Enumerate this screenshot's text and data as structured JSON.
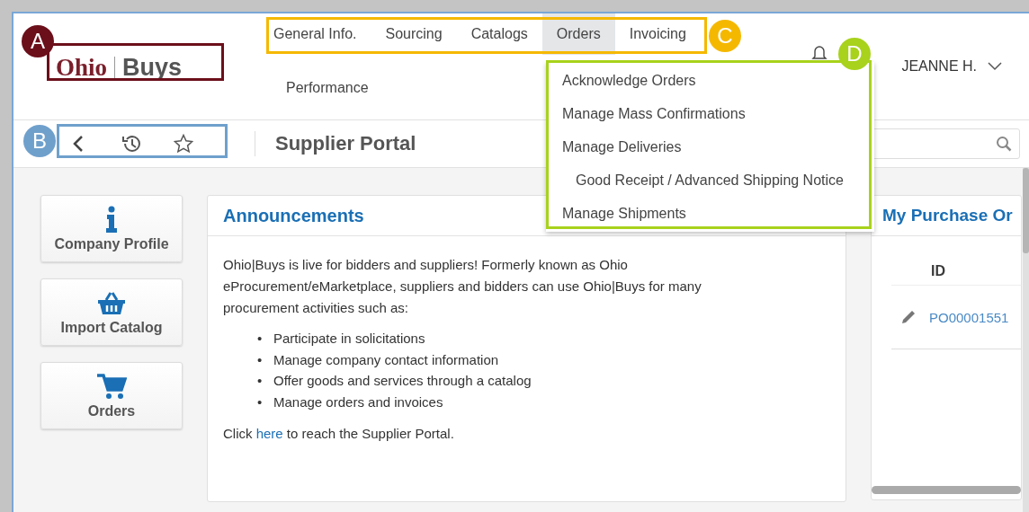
{
  "logo": {
    "name": "Ohio",
    "suffix": "Buys"
  },
  "nav": [
    {
      "label": "General Info.",
      "selected": false
    },
    {
      "label": "Sourcing",
      "selected": false
    },
    {
      "label": "Catalogs",
      "selected": false
    },
    {
      "label": "Orders",
      "selected": true
    },
    {
      "label": "Invoicing",
      "selected": false
    },
    {
      "label": "Performance",
      "selected": false
    }
  ],
  "user": {
    "name": "JEANNE H."
  },
  "toolbar": {
    "title": "Supplier Portal"
  },
  "tiles": [
    {
      "kind": "info",
      "label": "Company Profile"
    },
    {
      "kind": "basket",
      "label": "Import Catalog"
    },
    {
      "kind": "cart",
      "label": "Orders"
    }
  ],
  "announcements": {
    "title": "Announcements",
    "paragraph": "Ohio|Buys is live for bidders and suppliers! Formerly known as Ohio eProcurement/eMarketplace, suppliers and bidders can use Ohio|Buys for many procurement activities such as:",
    "bullets": [
      {
        "marker": "•",
        "text": "Participate in solicitations"
      },
      {
        "marker": "•",
        "text": "Manage company contact information"
      },
      {
        "marker": "•",
        "text": "Offer goods and services through a catalog"
      },
      {
        "marker": "•",
        "text": "Manage orders and invoices"
      }
    ],
    "closing": {
      "before": "Click ",
      "link": "here",
      "after": " to reach the Supplier Portal."
    }
  },
  "purchase_orders": {
    "title": "My Purchase Or",
    "columns": [
      "ID"
    ],
    "rows": [
      {
        "id": "PO00001551"
      }
    ]
  },
  "menu": [
    {
      "label": "Acknowledge Orders"
    },
    {
      "label": "Manage Mass Confirmations"
    },
    {
      "label": "Manage Deliveries",
      "children": [
        {
          "label": "Good Receipt / Advanced Shipping Notice"
        }
      ]
    },
    {
      "label": "Manage Shipments"
    }
  ],
  "callouts": [
    {
      "label": "A",
      "color": "#6b0f1a"
    },
    {
      "label": "B",
      "color": "#6fa0cc"
    },
    {
      "label": "C",
      "color": "#f5b800"
    },
    {
      "label": "D",
      "color": "#a8d21c"
    }
  ]
}
